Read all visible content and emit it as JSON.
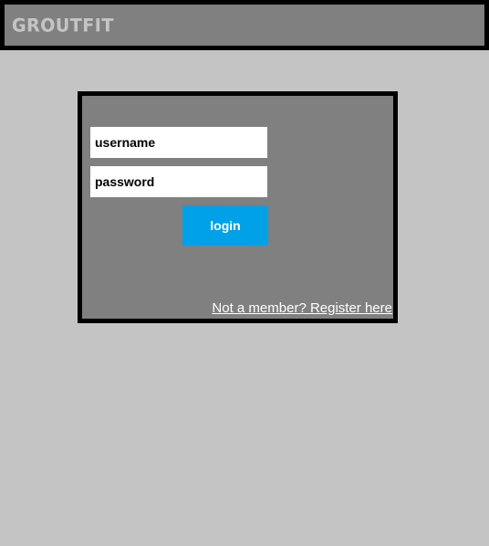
{
  "header": {
    "logo_text": "GROUTFIT"
  },
  "login_form": {
    "username_placeholder": "username",
    "password_placeholder": "password",
    "login_label": "login",
    "register_text": "Not a member? Register here"
  },
  "colors": {
    "page_background": "#c4c4c4",
    "panel_background": "#808080",
    "border": "#000000",
    "button_accent": "#00a1e6",
    "logo_text": "#c4c4c4",
    "link_text": "#ffffff"
  }
}
